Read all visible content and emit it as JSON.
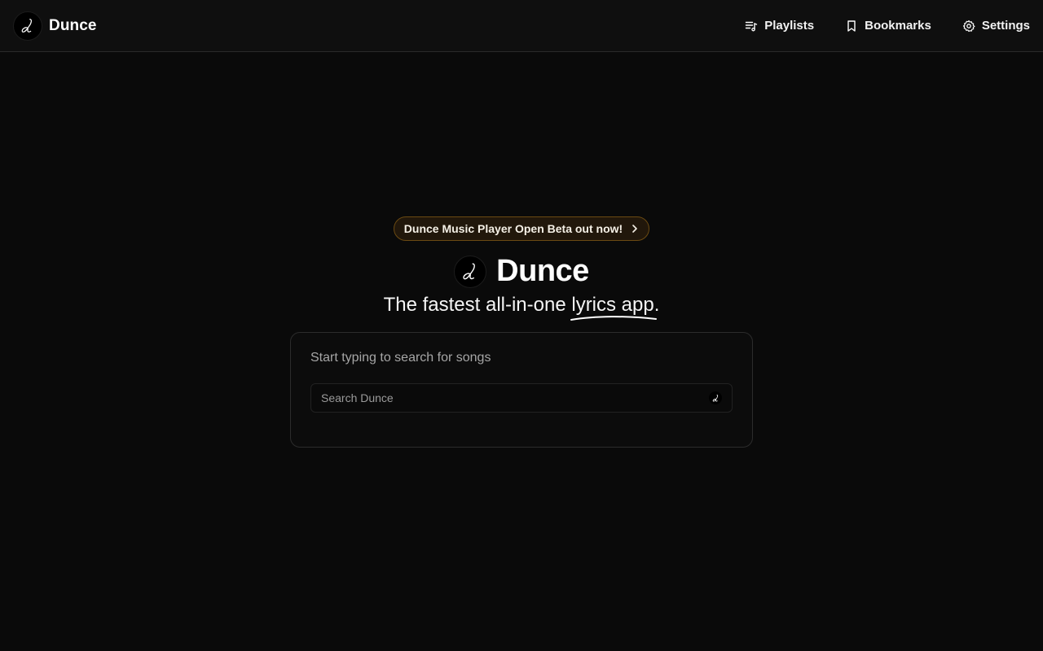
{
  "header": {
    "brand_name": "Dunce",
    "nav": [
      {
        "label": "Playlists",
        "icon": "playlist-icon"
      },
      {
        "label": "Bookmarks",
        "icon": "bookmark-icon"
      },
      {
        "label": "Settings",
        "icon": "gear-icon"
      }
    ]
  },
  "hero": {
    "banner_label": "Dunce Music Player Open Beta out now!",
    "title": "Dunce",
    "tagline_prefix": "The fastest all-in-one ",
    "tagline_highlight": "lyrics app",
    "tagline_suffix": "."
  },
  "search": {
    "hint": "Start typing to search for songs",
    "placeholder": "Search Dunce",
    "value": ""
  },
  "colors": {
    "background": "#0a0a0a",
    "banner_border": "#6b4a12",
    "banner_bg": "#21170b"
  }
}
